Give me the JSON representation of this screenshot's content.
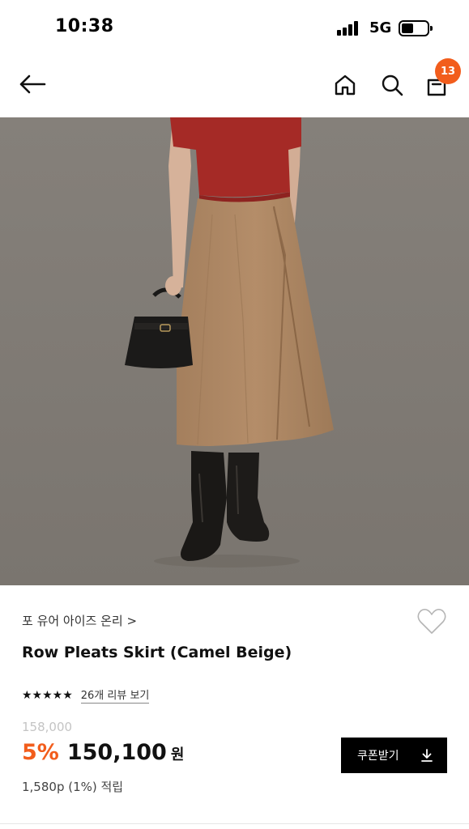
{
  "status_bar": {
    "time": "10:38",
    "network": "5G",
    "icons": [
      "signal-icon",
      "battery-icon"
    ]
  },
  "nav": {
    "icons": [
      "back-arrow-icon",
      "home-icon",
      "search-icon",
      "shopping-bag-icon"
    ],
    "cart_count": "13"
  },
  "product": {
    "image": "model in red knit top, camel beige pleated skirt, black boots, holding black handbag",
    "brand": "포 유어 아이즈 온리 >",
    "title": "Row Pleats Skirt (Camel Beige)",
    "rating_stars": "★★★★★",
    "review_link": "26개 리뷰 보기",
    "original_price": "158,000",
    "discount": "5%",
    "sale_price": "150,100",
    "currency": "원",
    "points": "1,580p (1%) 적립",
    "coupon_button": "쿠폰받기",
    "wish_icon": "heart-outline-icon"
  },
  "colors": {
    "accent": "#f25d1c",
    "background_photo": "#7f7a73",
    "button_bg": "#000000"
  }
}
